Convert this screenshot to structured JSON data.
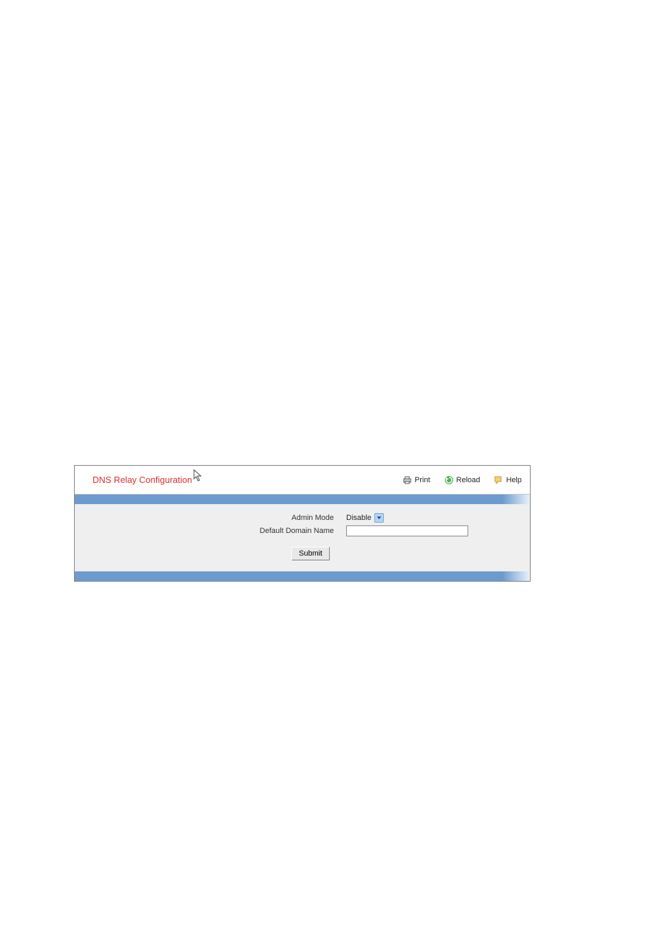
{
  "panel": {
    "title": "DNS Relay Configuration",
    "actions": {
      "print": "Print",
      "reload": "Reload",
      "help": "Help"
    }
  },
  "form": {
    "admin_mode_label": "Admin Mode",
    "admin_mode_value": "Disable",
    "default_domain_label": "Default Domain Name",
    "default_domain_value": "",
    "submit_label": "Submit"
  }
}
